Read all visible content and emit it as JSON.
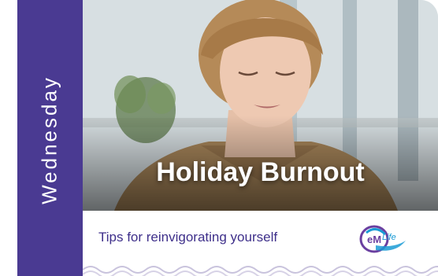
{
  "card": {
    "day": "Wednesday",
    "headline": "Holiday Burnout",
    "subtitle": "Tips for reinvigorating yourself",
    "logo": {
      "mark": "eM",
      "word": "Life"
    }
  },
  "colors": {
    "band": "#4a3a92",
    "subtitle": "#3e2f8a",
    "logo_purple": "#6a3fa0",
    "logo_blue": "#1a9bd5"
  },
  "icons": {
    "logo": "emlife-logo-icon"
  }
}
